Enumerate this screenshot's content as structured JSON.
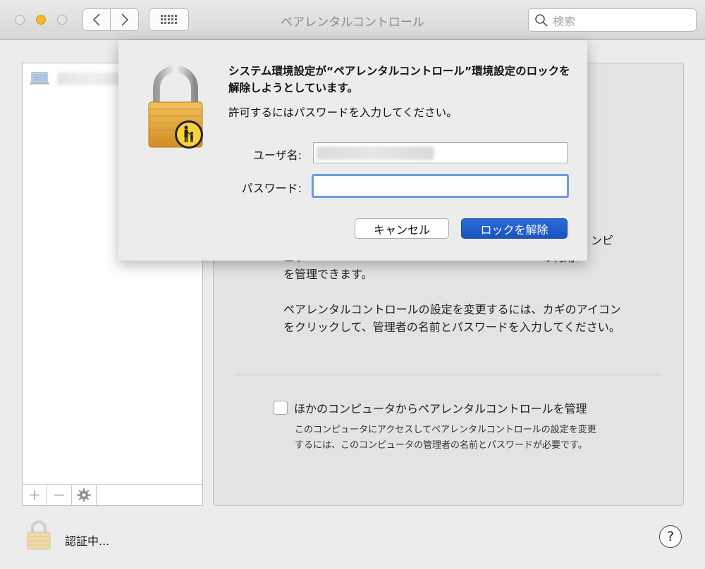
{
  "window": {
    "title": "ペアレンタルコントロール"
  },
  "toolbar": {
    "search_placeholder": "検索"
  },
  "sidebar": {
    "add_label": "+",
    "remove_label": "−"
  },
  "panel": {
    "description_partial": "ンピ\nュ、 、 、 の利用\nを管理できます。",
    "description_lock": "ペアレンタルコントロールの設定を変更するには、カギのアイコンをクリックして、管理者の名前とパスワードを入力してください。",
    "remote_manage_label": "ほかのコンピュータからペアレンタルコントロールを管理",
    "remote_manage_checked": false,
    "remote_manage_help": "このコンピュータにアクセスしてペアレンタルコントロールの設定を変更するには、このコンピュータの管理者の名前とパスワードが必要です。"
  },
  "footer": {
    "auth_status": "認証中...",
    "help_label": "?"
  },
  "auth_sheet": {
    "message": "システム環境設定が“ペアレンタルコントロール”環境設定のロックを解除しようとしています。",
    "instruction": "許可するにはパスワードを入力してください。",
    "username_label": "ユーザ名:",
    "password_label": "パスワード:",
    "password_value": "",
    "cancel_label": "キャンセル",
    "unlock_label": "ロックを解除"
  },
  "colors": {
    "accent": "#1f5fcf",
    "focus_ring": "#6f9ae0",
    "minimize_light": "#f5b52e",
    "lock_gold": "#e0a83a"
  }
}
